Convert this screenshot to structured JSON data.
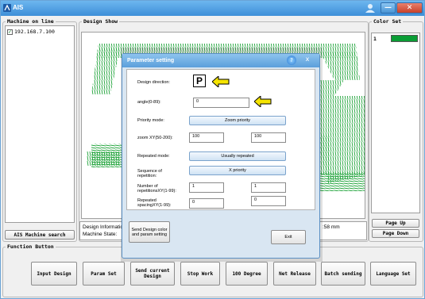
{
  "window": {
    "title": "AIS"
  },
  "machines": {
    "legend": "Machine on line",
    "items": [
      {
        "label": "192.168.7.100",
        "checked": true
      }
    ],
    "search_button": "AIS Machine search"
  },
  "design_show": {
    "legend": "Design Show",
    "info": {
      "line1": "Design Informatio",
      "line2": "Machine State:",
      "size_text": ":58 mm"
    }
  },
  "color_set": {
    "legend": "Color Set",
    "rows": [
      {
        "index": "1",
        "color": "#0a9d35"
      }
    ],
    "page_up": "Page Up",
    "page_down": "Page Down"
  },
  "function": {
    "legend": "Function Button",
    "buttons": {
      "input_design": "Input Design",
      "param_set": "Param Set",
      "send_current_1": "Send current",
      "send_current_2": "Design",
      "stop_work": "Stop Work",
      "degree_100": "100 Degree",
      "net_release": "Net Release",
      "batch_sending": "Batch sending",
      "language_set": "Language Set"
    }
  },
  "dialog": {
    "title": "Parameter setting",
    "help_symbol": "?",
    "close_symbol": "x",
    "design_direction_label": "Design direction:",
    "direction_value": "P",
    "angle_label": "angle(0-89):",
    "angle_value": "0",
    "priority_mode_label": "Priority mode:",
    "priority_mode_value": "Zoom priority",
    "zoom_label": "zoom XY(50-200):",
    "zoom_x": "100",
    "zoom_y": "100",
    "repeated_mode_label": "Repeated mode:",
    "repeated_mode_value": "Usually repeated",
    "sequence_label_1": "Sequence of",
    "sequence_label_2": "repetition:",
    "sequence_value": "X priority",
    "number_label_1": "Number of",
    "number_label_2": "repetitionsXY(1-99):",
    "number_x": "1",
    "number_y": "1",
    "spacing_label_1": "Repeated",
    "spacing_label_2": "spacingXY(1-99):",
    "spacing_x": "0",
    "spacing_y": "0",
    "send_color_1": "Send Design color",
    "send_color_2": "and param setting",
    "exit": "Exit"
  },
  "colors": {
    "highlight_arrow": "#f5e400",
    "stitch": "#1fa33a"
  }
}
